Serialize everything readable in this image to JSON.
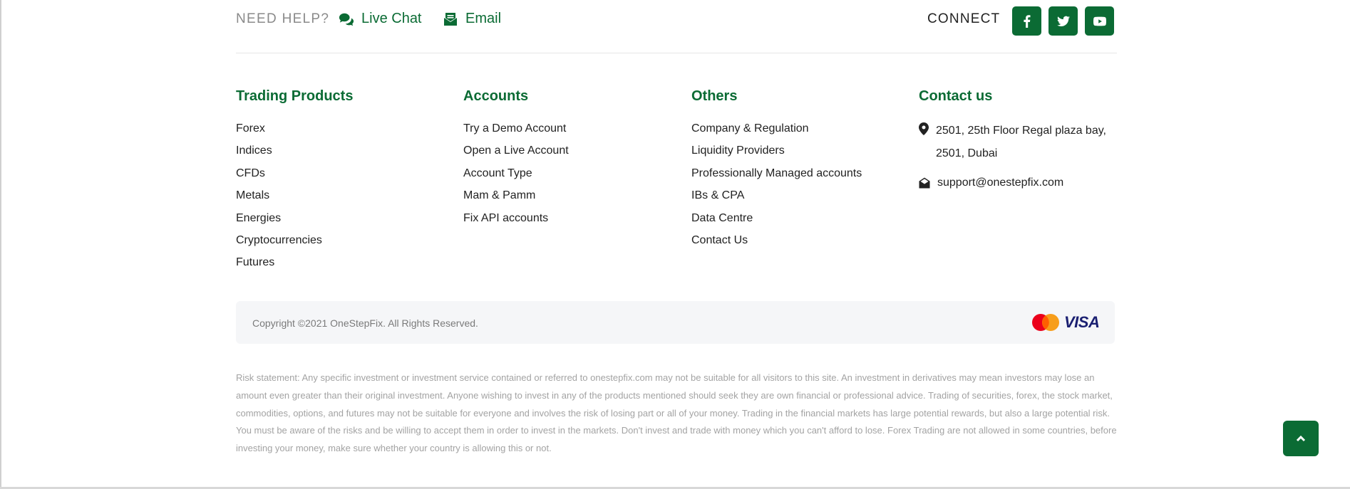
{
  "help_bar": {
    "need_help": "NEED HELP?",
    "live_chat": "Live Chat",
    "email": "Email",
    "connect": "CONNECT",
    "social_icons": [
      "facebook-icon",
      "twitter-icon",
      "youtube-icon"
    ]
  },
  "columns": {
    "trading_products": {
      "title": "Trading Products",
      "items": [
        "Forex",
        "Indices",
        "CFDs",
        "Metals",
        "Energies",
        "Cryptocurrencies",
        "Futures"
      ]
    },
    "accounts": {
      "title": "Accounts",
      "items": [
        "Try a Demo Account",
        "Open a Live Account",
        "Account Type",
        "Mam & Pamm",
        "Fix API accounts"
      ]
    },
    "others": {
      "title": "Others",
      "items": [
        "Company & Regulation",
        "Liquidity Providers",
        "Professionally Managed accounts",
        "IBs & CPA",
        "Data Centre",
        "Contact Us"
      ]
    },
    "contact": {
      "title": "Contact us",
      "address": "2501, 25th Floor Regal plaza bay, 2501, Dubai",
      "email": "support@onestepfix.com"
    }
  },
  "footer": {
    "copyright": "Copyright ©2021 OneStepFix. All Rights Reserved.",
    "visa": "VISA",
    "risk_statement": "Risk statement: Any specific investment or investment service contained or referred to onestepfix.com may not be suitable for all visitors to this site. An investment in derivatives may mean investors may lose an amount even greater than their original investment. Anyone wishing to invest in any of the products mentioned should seek they are own financial or professional advice. Trading of securities, forex, the stock market, commodities, options, and futures may not be suitable for everyone and involves the risk of losing part or all of your money. Trading in the financial markets has large potential rewards, but also a large potential risk. You must be aware of the risks and be willing to accept them in order to invest in the markets. Don't invest and trade with money which you can't afford to lose. Forex Trading are not allowed in some countries, before investing your money, make sure whether your country is allowing this or not."
  },
  "colors": {
    "brand_green": "#0b6b34",
    "muted_text": "#a3a3a3",
    "strip_bg": "#f5f6f8"
  }
}
